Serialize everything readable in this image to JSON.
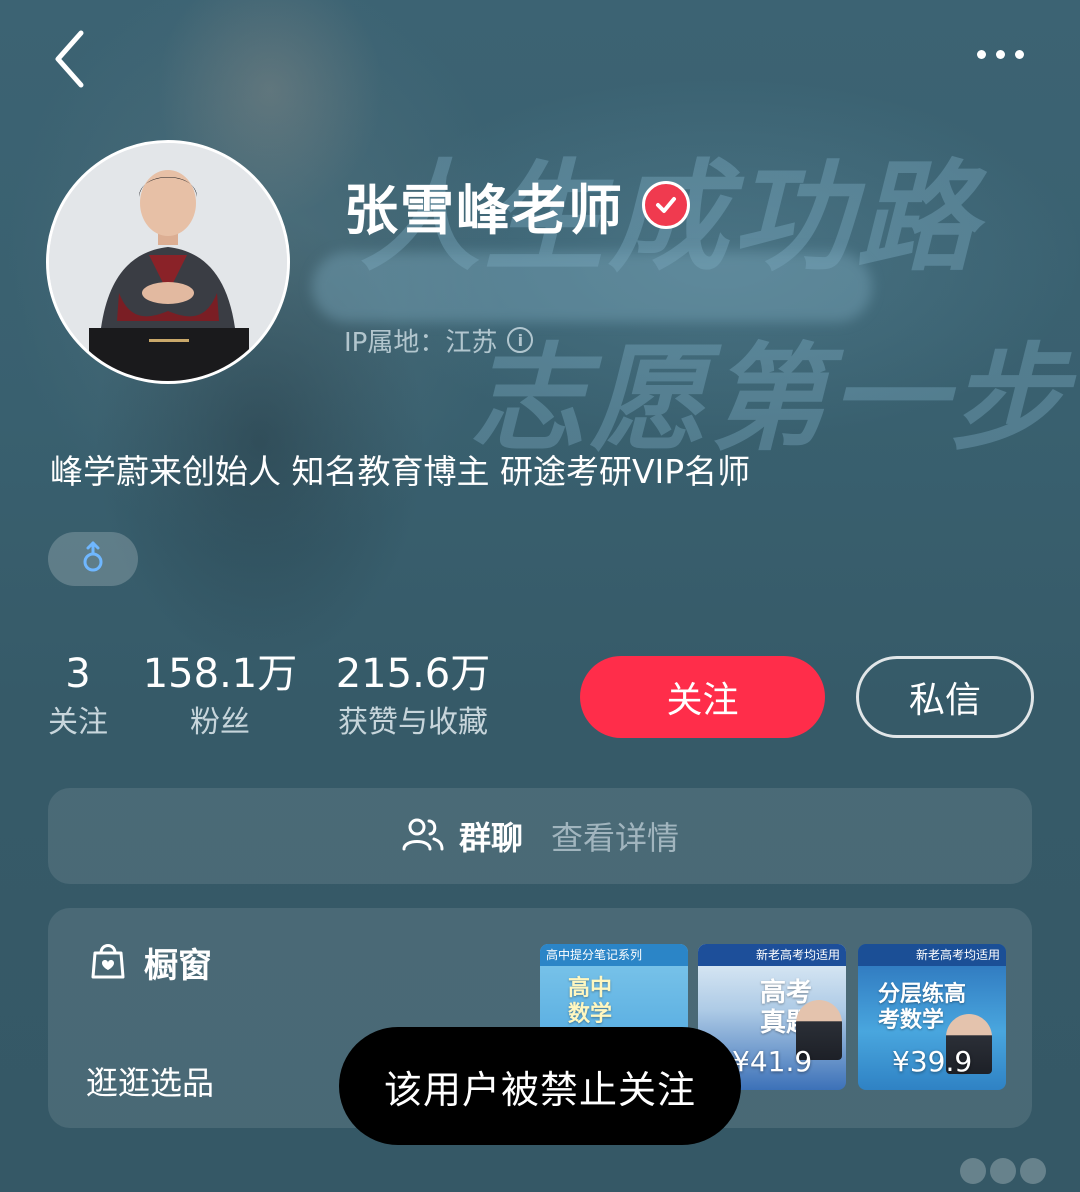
{
  "header": {
    "back_icon": "chevron-left-icon",
    "more_icon": "more-dots-icon"
  },
  "profile": {
    "name": "张雪峰老师",
    "verified_icon": "verified-check-icon",
    "ip_label": "IP属地：江苏",
    "bio": "峰学蔚来创始人 知名教育博主 研途考研VIP名师",
    "gender_icon": "male-icon"
  },
  "background": {
    "slogan_line1": "人生成功路",
    "slogan_line2": "志愿第一步"
  },
  "stats": [
    {
      "value": "3",
      "label": "关注"
    },
    {
      "value": "158.1万",
      "label": "粉丝"
    },
    {
      "value": "215.6万",
      "label": "获赞与收藏"
    }
  ],
  "actions": {
    "follow_label": "关注",
    "message_label": "私信"
  },
  "group_chat": {
    "icon": "group-users-icon",
    "title": "群聊",
    "link": "查看详情"
  },
  "showcase": {
    "icon": "shopping-bag-icon",
    "title": "橱窗",
    "subtitle": "逛逛选品",
    "products": [
      {
        "tag": "高中提分笔记系列",
        "cover": "高中数学提分笔记",
        "price": ""
      },
      {
        "tag": "新老高考均适用",
        "cover": "高考真题",
        "price": "¥41.9"
      },
      {
        "tag": "新老高考均适用",
        "cover": "分层练高考数学",
        "price": "¥39.9"
      }
    ]
  },
  "toast": {
    "message": "该用户被禁止关注"
  },
  "colors": {
    "accent": "#ff2d4a",
    "verified": "#f03a4f",
    "background": "#39606f"
  }
}
